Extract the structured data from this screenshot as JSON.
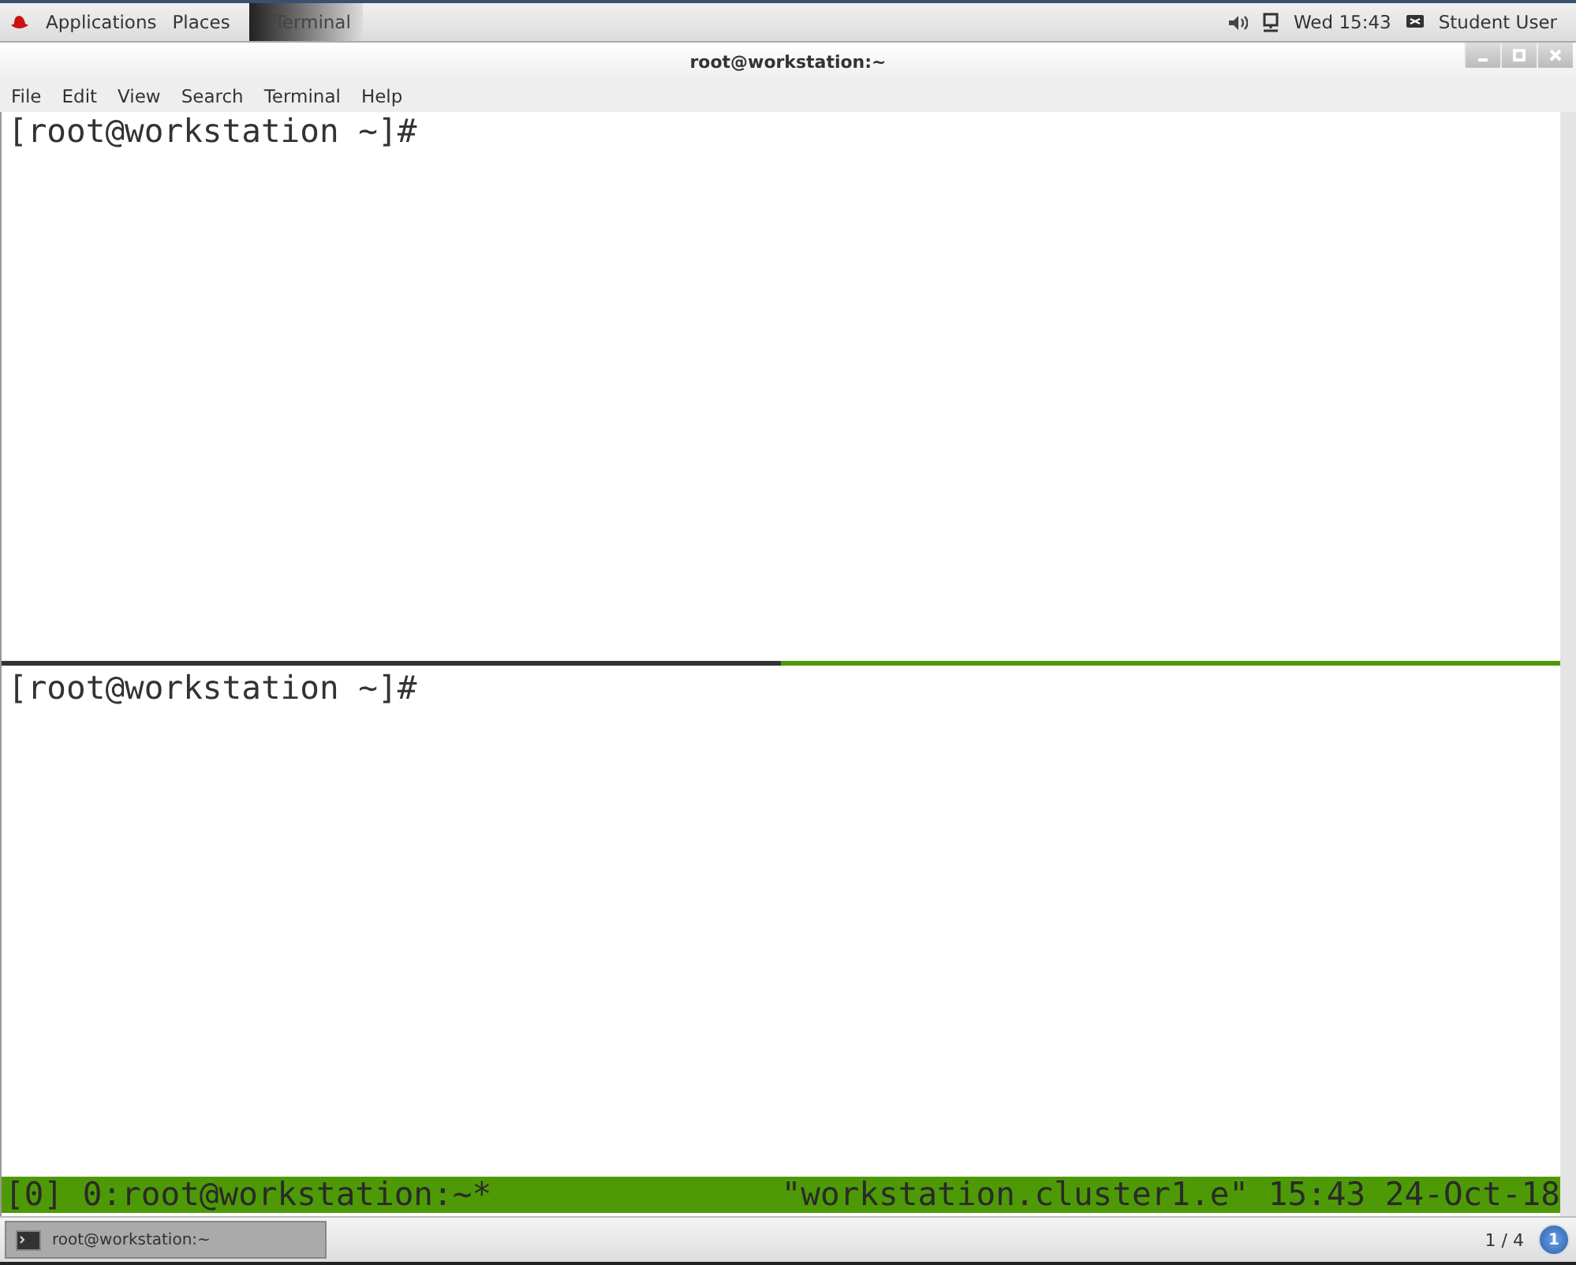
{
  "top_bar": {
    "menus": [
      "Applications",
      "Places"
    ],
    "task": "Terminal",
    "clock": "Wed 15:43",
    "user": "Student User"
  },
  "window": {
    "title": "root@workstation:~"
  },
  "menu": [
    "File",
    "Edit",
    "View",
    "Search",
    "Terminal",
    "Help"
  ],
  "panes": [
    {
      "prompt": "[root@workstation ~]#",
      "active": false
    },
    {
      "prompt": "[root@workstation ~]#",
      "active": true
    }
  ],
  "tmux_status": {
    "left": "[0] 0:root@workstation:~*",
    "right": "\"workstation.cluster1.e\" 15:43 24-Oct-18"
  },
  "taskbar": {
    "window": "root@workstation:~",
    "workspace": "1 / 4",
    "notifications": "1"
  }
}
